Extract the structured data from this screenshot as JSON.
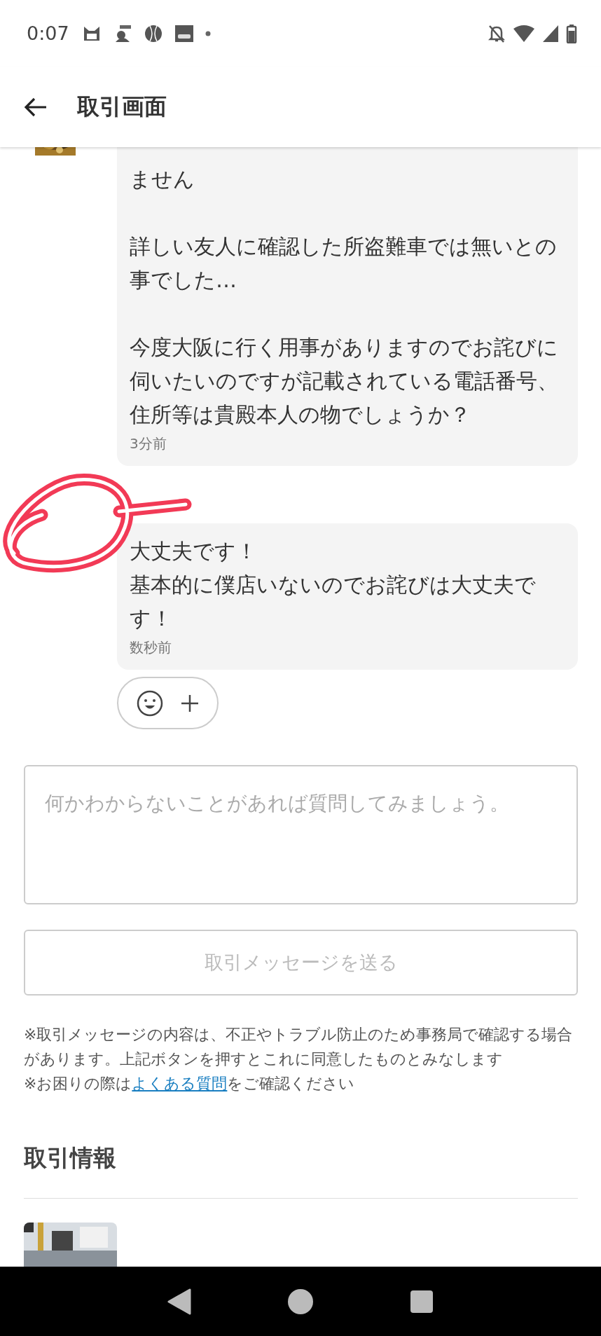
{
  "status_bar": {
    "time": "0:07"
  },
  "header": {
    "title": "取引画面"
  },
  "messages": [
    {
      "avatar": {
        "kind": "picture"
      },
      "paragraphs": [
        [
          "ません"
        ],
        [
          "詳しい友人に確認した所盗難車では無いとの事でした…"
        ],
        [
          "今度大阪に行く用事がありますのでお詫びに伺いたいのですが記載されている電話番号、住所等は貴殿本人の物でしょうか？"
        ]
      ],
      "time": "3分前"
    },
    {
      "paragraphs": [
        [
          "大丈夫です！",
          "基本的に僕店いないのでお詫びは大丈夫です！"
        ]
      ],
      "time": "数秒前"
    }
  ],
  "message_input": {
    "placeholder": "何かわからないことがあれば質問してみましょう。"
  },
  "send_button": {
    "label": "取引メッセージを送る",
    "disabled": true
  },
  "notes": [
    {
      "text": "※取引メッセージの内容は、不正やトラブル防止のため事務局で確認する場合があります。上記ボタンを押すとこれに同意したものとみなします"
    },
    {
      "before": "※お困りの際は",
      "link": "よくある質問",
      "after": "をご確認ください"
    }
  ],
  "section": {
    "title": "取引情報",
    "item": {
      "kind": "picture"
    }
  }
}
